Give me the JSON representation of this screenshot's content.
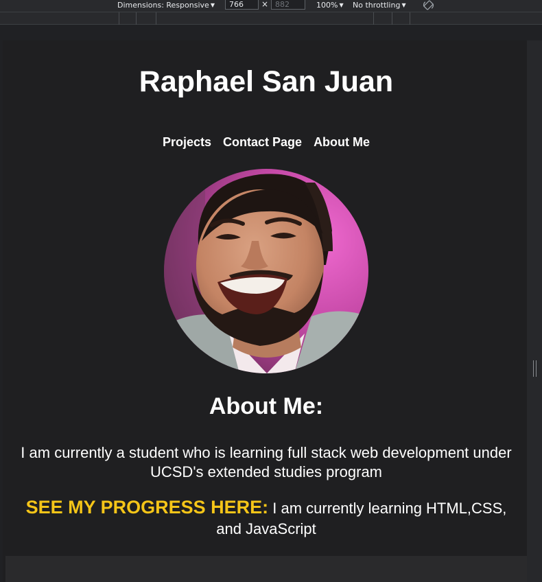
{
  "devtools": {
    "dimensions_label": "Dimensions: Responsive",
    "width_value": "766",
    "times_symbol": "×",
    "height_placeholder": "882",
    "zoom_label": "100%",
    "throttle_label": "No throttling",
    "rotate_icon": "rotate-icon"
  },
  "site": {
    "title": "Raphael San Juan",
    "nav": [
      "Projects",
      "Contact Page",
      "About Me"
    ],
    "about_heading": "About Me:",
    "about_text": "I am currently a student who is learning full stack web development under UCSD's extended studies program",
    "progress_highlight": "SEE MY PROGRESS HERE:",
    "progress_text": " I am currently learning HTML,CSS, and JavaScript",
    "highlight_color": "#f5c518"
  }
}
